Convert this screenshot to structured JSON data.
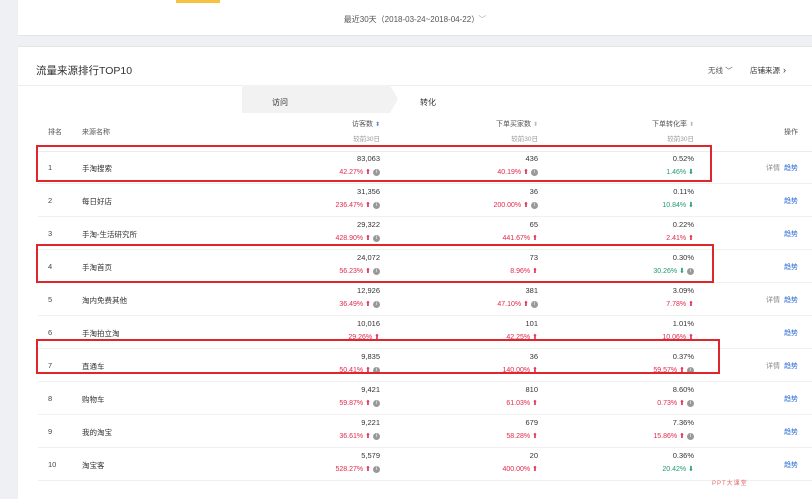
{
  "date_filter": {
    "label": "最近30天（2018-03-24~2018-04-22）"
  },
  "card": {
    "title": "流量来源排行TOP10",
    "device": "无线",
    "shop_source": "店铺来源"
  },
  "groups": {
    "visit": "访问",
    "conversion": "转化"
  },
  "columns": {
    "rank": "排名",
    "source": "来源名称",
    "visitors": "访客数",
    "orders": "下单买家数",
    "conv_rate": "下单转化率",
    "compare": "较前30日",
    "ops": "操作"
  },
  "actions": {
    "detail": "详情",
    "trend": "趋势"
  },
  "rows": [
    {
      "rank": "1",
      "name": "手淘搜索",
      "visitors": "83,063",
      "visitors_pct": "42.27%",
      "orders": "436",
      "orders_pct": "40.19%",
      "rate": "0.52%",
      "rate_pct": "1.46%"
    },
    {
      "rank": "2",
      "name": "每日好店",
      "visitors": "31,356",
      "visitors_pct": "236.47%",
      "orders": "36",
      "orders_pct": "200.00%",
      "rate": "0.11%",
      "rate_pct": "10.84%"
    },
    {
      "rank": "3",
      "name": "手淘-生活研究所",
      "visitors": "29,322",
      "visitors_pct": "428.90%",
      "orders": "65",
      "orders_pct": "441.67%",
      "rate": "0.22%",
      "rate_pct": "2.41%"
    },
    {
      "rank": "4",
      "name": "手淘首页",
      "visitors": "24,072",
      "visitors_pct": "56.23%",
      "orders": "73",
      "orders_pct": "8.96%",
      "rate": "0.30%",
      "rate_pct": "30.26%"
    },
    {
      "rank": "5",
      "name": "淘内免费其他",
      "visitors": "12,926",
      "visitors_pct": "36.49%",
      "orders": "381",
      "orders_pct": "47.10%",
      "rate": "3.09%",
      "rate_pct": "7.78%"
    },
    {
      "rank": "6",
      "name": "手淘拍立淘",
      "visitors": "10,016",
      "visitors_pct": "29.26%",
      "orders": "101",
      "orders_pct": "42.25%",
      "rate": "1.01%",
      "rate_pct": "10.06%"
    },
    {
      "rank": "7",
      "name": "直通车",
      "visitors": "9,835",
      "visitors_pct": "50.41%",
      "orders": "36",
      "orders_pct": "140.00%",
      "rate": "0.37%",
      "rate_pct": "59.57%"
    },
    {
      "rank": "8",
      "name": "购物车",
      "visitors": "9,421",
      "visitors_pct": "59.87%",
      "orders": "810",
      "orders_pct": "61.03%",
      "rate": "8.60%",
      "rate_pct": "0.73%"
    },
    {
      "rank": "9",
      "name": "我的淘宝",
      "visitors": "9,221",
      "visitors_pct": "36.61%",
      "orders": "679",
      "orders_pct": "58.28%",
      "rate": "7.36%",
      "rate_pct": "15.86%"
    },
    {
      "rank": "10",
      "name": "淘宝客",
      "visitors": "5,579",
      "visitors_pct": "528.27%",
      "orders": "20",
      "orders_pct": "400.00%",
      "rate": "0.36%",
      "rate_pct": "20.42%"
    }
  ],
  "watermark": "PPT大课堂",
  "colors": {
    "up": "#e0284a",
    "down": "#1f9c6b",
    "link": "#2a6bd6",
    "highlight": "#e0262d"
  }
}
